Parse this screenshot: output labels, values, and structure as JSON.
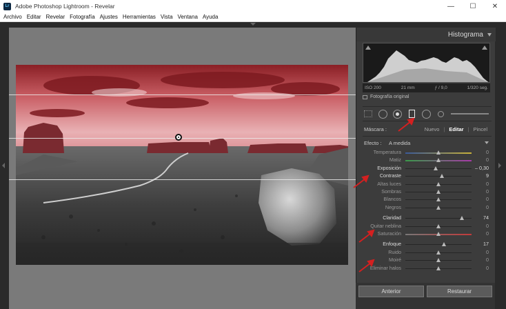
{
  "window": {
    "title": "Adobe Photoshop Lightroom - Revelar",
    "icon": "Lr"
  },
  "menu": [
    "Archivo",
    "Editar",
    "Revelar",
    "Fotografía",
    "Ajustes",
    "Herramientas",
    "Vista",
    "Ventana",
    "Ayuda"
  ],
  "panel": {
    "title": "Histograma",
    "histogram_info": {
      "iso": "ISO 200",
      "focal": "21 mm",
      "aperture": "ƒ / 9,0",
      "shutter": "1/320 seg."
    },
    "original_photo": "Fotografía original",
    "mask_label": "Máscara :",
    "mask_options": [
      "Nuevo",
      "Editar",
      "Pincel"
    ],
    "mask_active": "Editar",
    "effect_label": "Efecto :",
    "effect_value": "A medida",
    "sliders": [
      {
        "label": "Temperatura",
        "value": "0",
        "pos": 0.5,
        "gradient": "temp"
      },
      {
        "label": "Matiz",
        "value": "0",
        "pos": 0.5,
        "gradient": "tint"
      },
      {
        "label": "Exposición",
        "value": "– 0,30",
        "pos": 0.46,
        "bright": true
      },
      {
        "label": "Contraste",
        "value": "9",
        "pos": 0.55,
        "bright": true
      },
      {
        "label": "Altas luces",
        "value": "0",
        "pos": 0.5
      },
      {
        "label": "Sombras",
        "value": "0",
        "pos": 0.5
      },
      {
        "label": "Blancos",
        "value": "0",
        "pos": 0.5
      },
      {
        "label": "Negros",
        "value": "0",
        "pos": 0.5
      },
      {
        "label": "Claridad",
        "value": "74",
        "pos": 0.85,
        "bright": true
      },
      {
        "label": "Quitar neblina",
        "value": "0",
        "pos": 0.5
      },
      {
        "label": "Saturación",
        "value": "0",
        "pos": 0.5,
        "gradient": "sat"
      },
      {
        "label": "Enfoque",
        "value": "17",
        "pos": 0.58,
        "bright": true
      },
      {
        "label": "Ruido",
        "value": "0",
        "pos": 0.5
      },
      {
        "label": "Moiré",
        "value": "0",
        "pos": 0.5
      },
      {
        "label": "Eliminar halos",
        "value": "0",
        "pos": 0.5
      }
    ],
    "buttons": {
      "prev": "Anterior",
      "reset": "Restaurar"
    }
  },
  "colors": {
    "accent_red": "#d42020",
    "mask_overlay": "#c8303c"
  },
  "icons": {
    "tool_crop": "grid-icon",
    "tool_spot": "circle-slider-icon",
    "tool_redeye": "eye-icon",
    "tool_graduated": "rectangle-icon",
    "tool_radial": "circle-icon"
  }
}
